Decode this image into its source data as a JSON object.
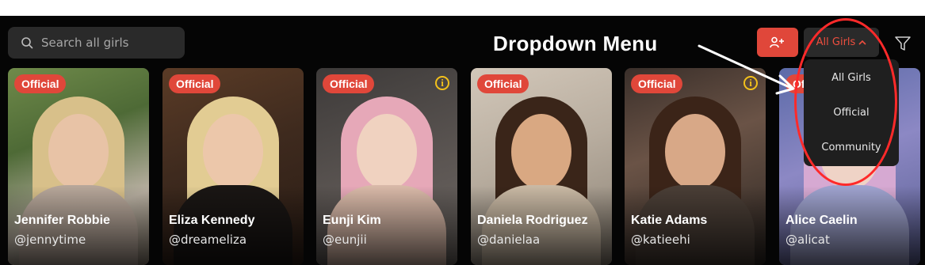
{
  "search": {
    "placeholder": "Search all girls"
  },
  "annotation": {
    "label": "Dropdown Menu"
  },
  "toolbar": {
    "add_icon": "user-plus-icon",
    "dropdown_label": "All Girls",
    "dropdown_chevron": "^",
    "filter_icon": "filter-icon"
  },
  "dropdown": {
    "options": [
      "All Girls",
      "Official",
      "Community"
    ]
  },
  "cards": [
    {
      "badge": "Official",
      "name": "Jennifer Robbie",
      "handle": "@jennytime",
      "info": false
    },
    {
      "badge": "Official",
      "name": "Eliza Kennedy",
      "handle": "@dreameliza",
      "info": false
    },
    {
      "badge": "Official",
      "name": "Eunji Kim",
      "handle": "@eunjii",
      "info": true,
      "info_symbol": "i"
    },
    {
      "badge": "Official",
      "name": "Daniela Rodriguez",
      "handle": "@danielaa",
      "info": false
    },
    {
      "badge": "Official",
      "name": "Katie Adams",
      "handle": "@katieehi",
      "info": true,
      "info_symbol": "i"
    },
    {
      "badge": "Off",
      "name": "Alice Caelin",
      "handle": "@alicat",
      "info": false
    }
  ],
  "colors": {
    "accent": "#e0473a",
    "accent_text": "#ef4f3f",
    "annotation_red": "#ff2a2a",
    "info_yellow": "#f3c11b"
  }
}
